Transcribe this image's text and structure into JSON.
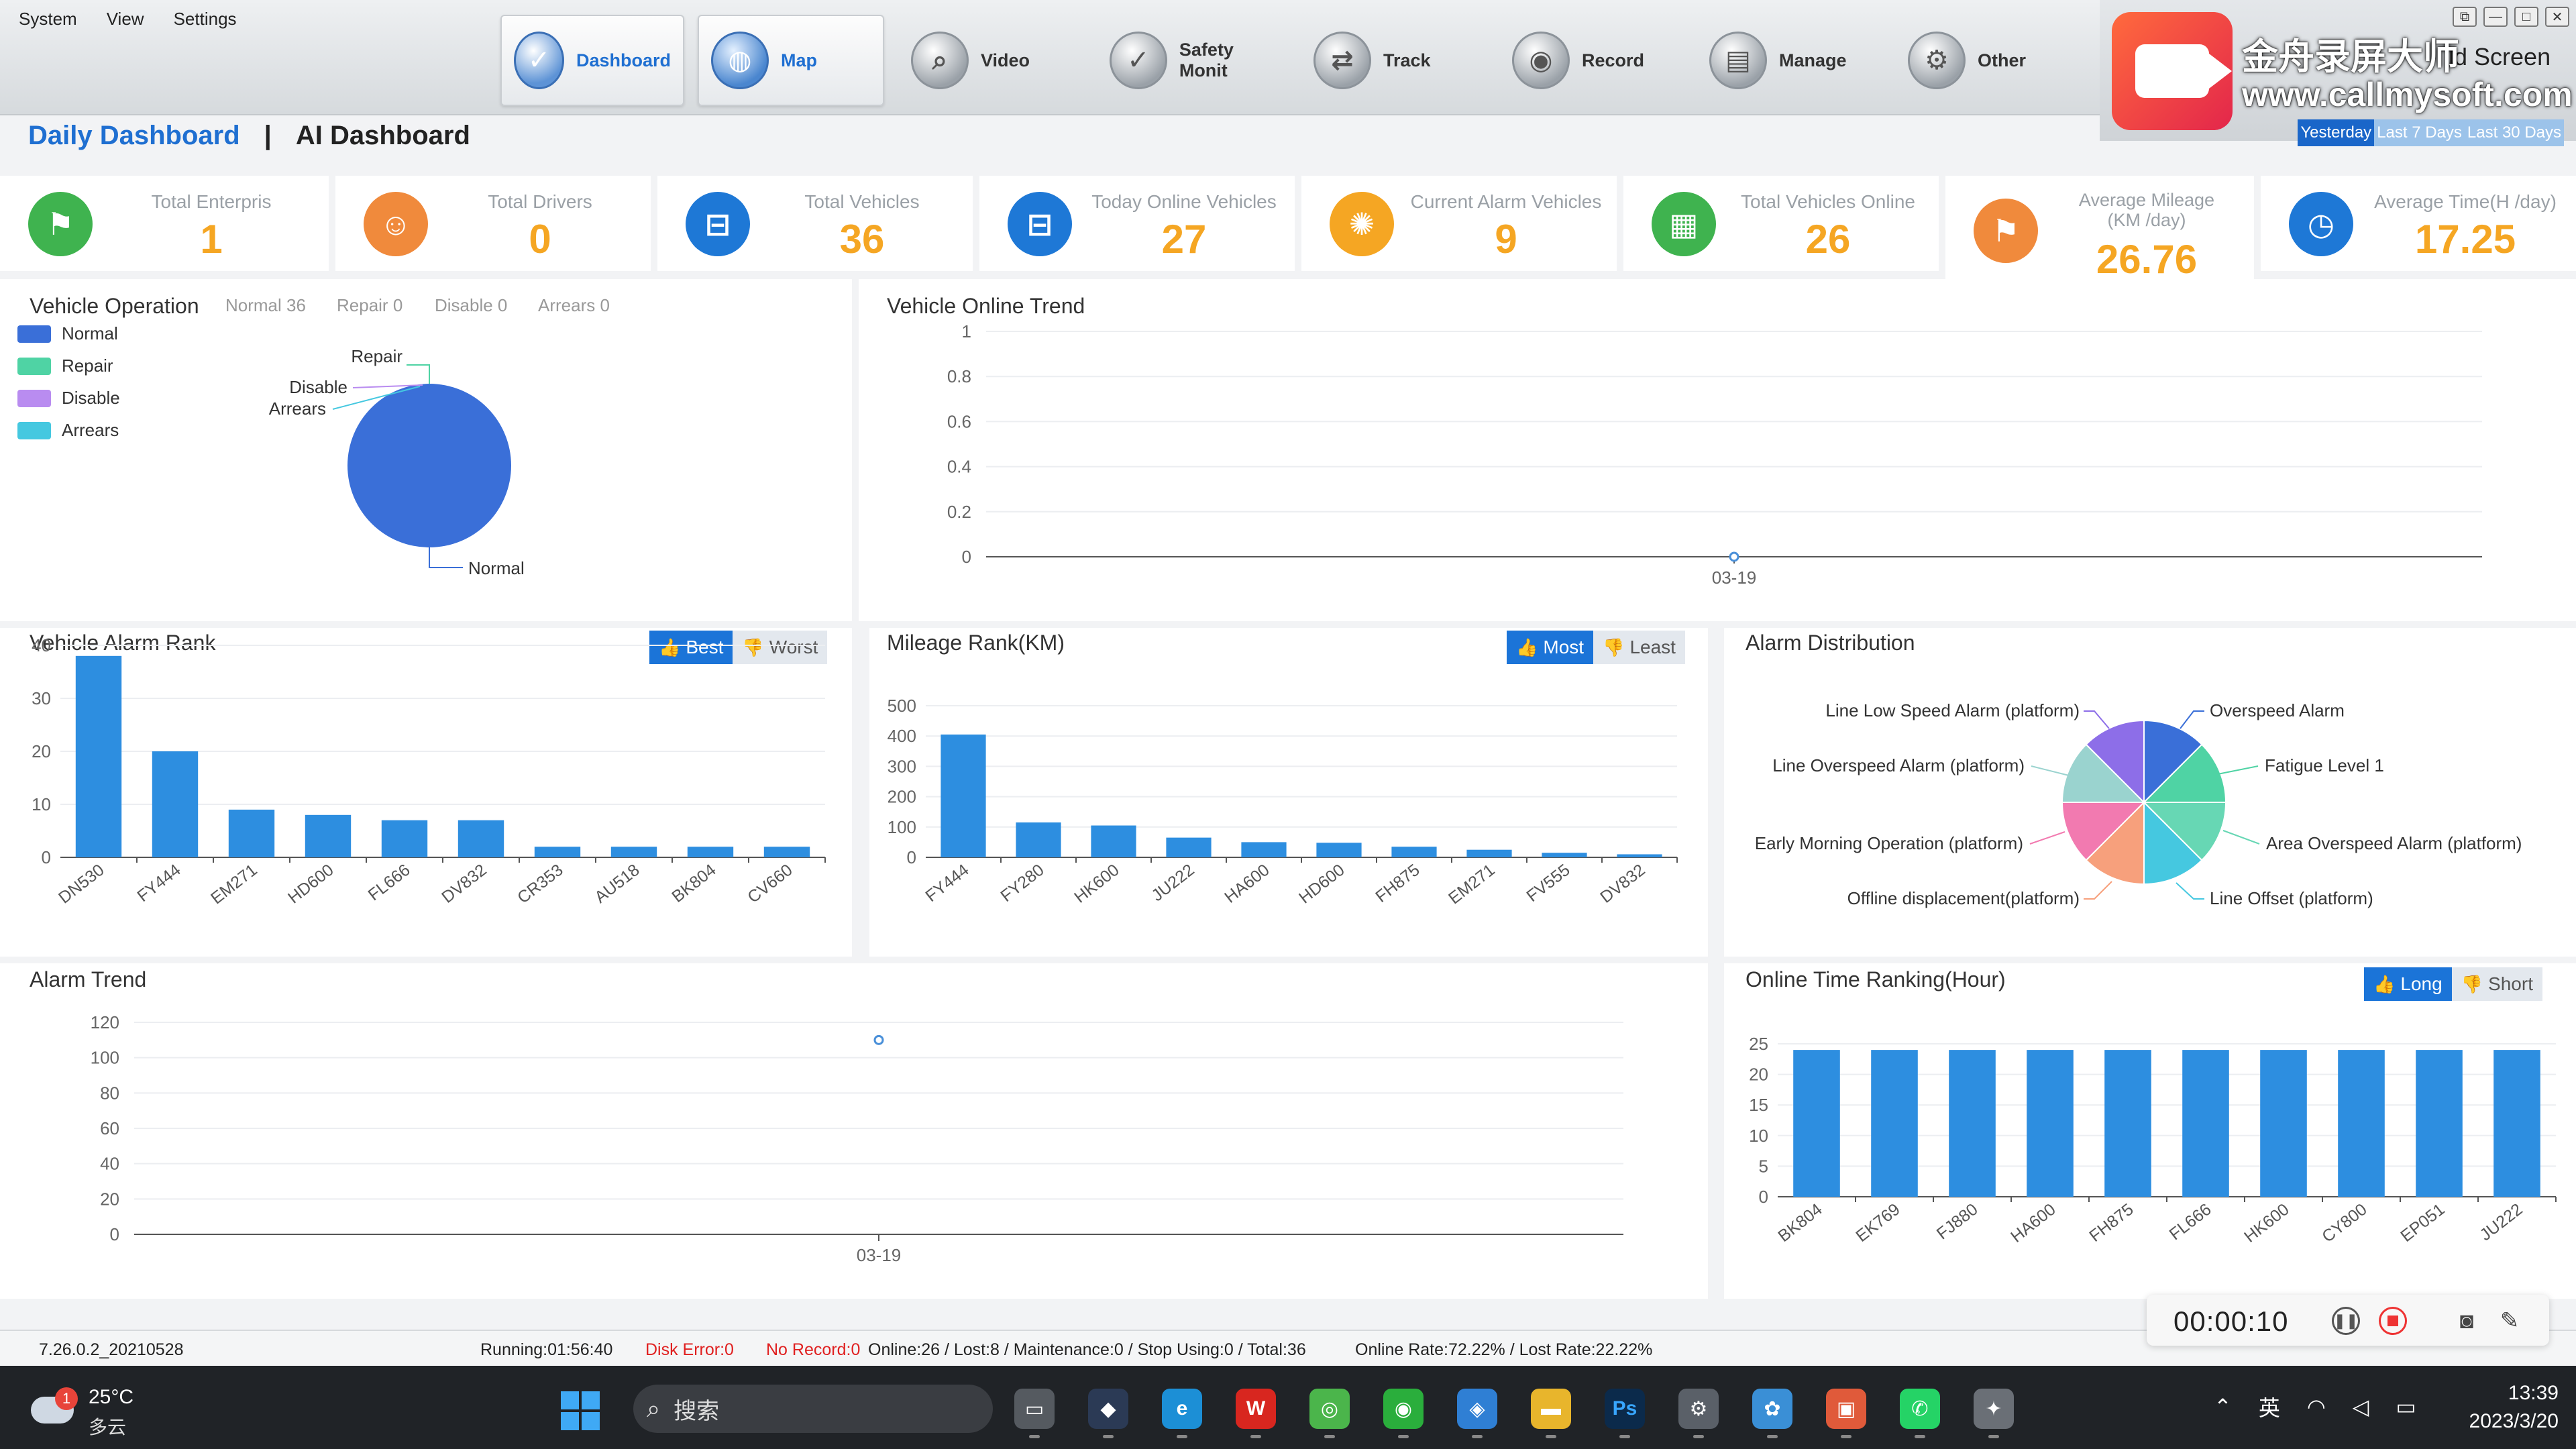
{
  "menu": {
    "system": "System",
    "view": "View",
    "settings": "Settings"
  },
  "nav": [
    {
      "label": "Dashboard",
      "icon": "shield-check-icon",
      "glyph": "✓"
    },
    {
      "label": "Map",
      "icon": "globe-icon",
      "glyph": "◍"
    },
    {
      "label": "Video",
      "icon": "camera-icon",
      "glyph": "⌕"
    },
    {
      "label": "Safety Monit",
      "icon": "shield-icon",
      "glyph": "✓"
    },
    {
      "label": "Track",
      "icon": "track-icon",
      "glyph": "⇄"
    },
    {
      "label": "Record",
      "icon": "record-icon",
      "glyph": "◉"
    },
    {
      "label": "Manage",
      "icon": "manage-icon",
      "glyph": "▤"
    },
    {
      "label": "Other",
      "icon": "other-icon",
      "glyph": "⚙"
    }
  ],
  "watermark": {
    "title": "金舟录屏大师",
    "url": "www.callmysoft.com",
    "behind": "ld Screen"
  },
  "window_controls": [
    "⧉",
    "—",
    "□",
    "✕"
  ],
  "period": [
    "Yesterday",
    "Last 7 Days",
    "Last 30 Days"
  ],
  "dash_tabs": {
    "daily": "Daily Dashboard",
    "sep": "|",
    "ai": "AI Dashboard"
  },
  "stats": [
    {
      "label": "Total Enterpris",
      "value": "1",
      "color": "#3fb34f",
      "icon": "flag-icon",
      "glyph": "⚑"
    },
    {
      "label": "Total Drivers",
      "value": "0",
      "color": "#f08a3c",
      "icon": "driver-icon",
      "glyph": "☺"
    },
    {
      "label": "Total Vehicles",
      "value": "36",
      "color": "#1e78d6",
      "icon": "car-icon",
      "glyph": "⊟"
    },
    {
      "label": "Today Online Vehicles",
      "value": "27",
      "color": "#1e78d6",
      "icon": "car-icon",
      "glyph": "⊟"
    },
    {
      "label": "Current Alarm Vehicles",
      "value": "9",
      "color": "#f5a623",
      "icon": "alarm-icon",
      "glyph": "✺"
    },
    {
      "label": "Total Vehicles Online",
      "value": "26",
      "color": "#3fb34f",
      "icon": "calendar-icon",
      "glyph": "▦"
    },
    {
      "label": "Average Mileage\n(KM /day)",
      "value": "26.76",
      "color": "#f08a3c",
      "icon": "flag-icon",
      "glyph": "⚑"
    },
    {
      "label": "Average Time(H /day)",
      "value": "17.25",
      "color": "#1e78d6",
      "icon": "clock-icon",
      "glyph": "◷"
    }
  ],
  "vehicle_operation": {
    "title": "Vehicle Operation",
    "stats": [
      "Normal 36",
      "Repair 0",
      "Disable 0",
      "Arrears 0"
    ],
    "legend": [
      {
        "name": "Normal",
        "color": "#3a6fd8"
      },
      {
        "name": "Repair",
        "color": "#4fd3a4"
      },
      {
        "name": "Disable",
        "color": "#b98cf0"
      },
      {
        "name": "Arrears",
        "color": "#45c8e0"
      }
    ]
  },
  "online_trend": {
    "title": "Vehicle Online Trend"
  },
  "alarm_rank": {
    "title": "Vehicle Alarm Rank",
    "best": "Best",
    "worst": "Worst"
  },
  "mileage_rank": {
    "title": "Mileage Rank(KM)",
    "most": "Most",
    "least": "Least"
  },
  "alarm_distribution": {
    "title": "Alarm Distribution"
  },
  "alarm_trend": {
    "title": "Alarm Trend"
  },
  "online_time": {
    "title": "Online Time Ranking(Hour)",
    "long": "Long",
    "short": "Short"
  },
  "chart_data": [
    {
      "id": "vehicle_operation",
      "type": "pie",
      "labels": [
        "Normal",
        "Repair",
        "Disable",
        "Arrears"
      ],
      "values": [
        36,
        0,
        0,
        0
      ],
      "colors": [
        "#3a6fd8",
        "#4fd3a4",
        "#b98cf0",
        "#45c8e0"
      ]
    },
    {
      "id": "online_trend",
      "type": "line",
      "x": [
        "03-19"
      ],
      "values": [
        0
      ],
      "ylim": [
        0,
        1
      ],
      "yticks": [
        0,
        0.2,
        0.4,
        0.6,
        0.8,
        1
      ],
      "grid": true
    },
    {
      "id": "alarm_rank",
      "type": "bar",
      "categories": [
        "DN530",
        "FY444",
        "EM271",
        "HD600",
        "FL666",
        "DV832",
        "CR353",
        "AU518",
        "BK804",
        "CV660"
      ],
      "values": [
        38,
        20,
        9,
        8,
        7,
        7,
        2,
        2,
        2,
        2
      ],
      "ylim": [
        0,
        40
      ],
      "yticks": [
        0,
        10,
        20,
        30,
        40
      ],
      "color": "#2d8ee0"
    },
    {
      "id": "mileage_rank",
      "type": "bar",
      "categories": [
        "FY444",
        "FY280",
        "HK600",
        "JU222",
        "HA600",
        "HD600",
        "FH875",
        "EM271",
        "FV555",
        "DV832"
      ],
      "values": [
        405,
        115,
        105,
        65,
        50,
        48,
        35,
        25,
        15,
        10
      ],
      "ylim": [
        0,
        500
      ],
      "yticks": [
        0,
        100,
        200,
        300,
        400,
        500
      ],
      "color": "#2d8ee0"
    },
    {
      "id": "alarm_distribution",
      "type": "pie",
      "labels": [
        "Overspeed Alarm",
        "Fatigue Level 1",
        "Area Overspeed Alarm (platform)",
        "Line Offset (platform)",
        "Offline displacement(platform)",
        "Early Morning Operation (platform)",
        "Line Overspeed Alarm (platform)",
        "Line Low Speed Alarm (platform)"
      ],
      "values": [
        1,
        1,
        1,
        1,
        1,
        1,
        1,
        1
      ],
      "colors": [
        "#3a6fd8",
        "#4fd3a4",
        "#67d7b4",
        "#45c8e0",
        "#f7a07c",
        "#f27ab0",
        "#9ad3cf",
        "#8d6ee8"
      ]
    },
    {
      "id": "alarm_trend",
      "type": "line",
      "x": [
        "03-19"
      ],
      "values": [
        110
      ],
      "ylim": [
        0,
        120
      ],
      "yticks": [
        0,
        20,
        40,
        60,
        80,
        100,
        120
      ],
      "grid": true
    },
    {
      "id": "online_time",
      "type": "bar",
      "categories": [
        "BK804",
        "EK769",
        "FJ880",
        "HA600",
        "FH875",
        "FL666",
        "HK600",
        "CY800",
        "EP051",
        "JU222"
      ],
      "values": [
        24,
        24,
        24,
        24,
        24,
        24,
        24,
        24,
        24,
        24
      ],
      "ylim": [
        0,
        25
      ],
      "yticks": [
        0,
        5,
        10,
        15,
        20,
        25
      ],
      "color": "#2d8ee0"
    }
  ],
  "status": {
    "version": "7.26.0.2_20210528",
    "running": "Running:01:56:40",
    "disk_error": "Disk Error:0",
    "no_record": "No Record:0",
    "counts": "Online:26 / Lost:8 / Maintenance:0 / Stop Using:0 / Total:36",
    "rates": "Online Rate:72.22% / Lost Rate:22.22%"
  },
  "recorder": {
    "time": "00:00:10"
  },
  "taskbar": {
    "weather_temp": "25°C",
    "weather_cond": "多云",
    "weather_badge": "1",
    "search_placeholder": "搜索",
    "ime": "英",
    "time": "13:39",
    "date": "2023/3/20"
  }
}
